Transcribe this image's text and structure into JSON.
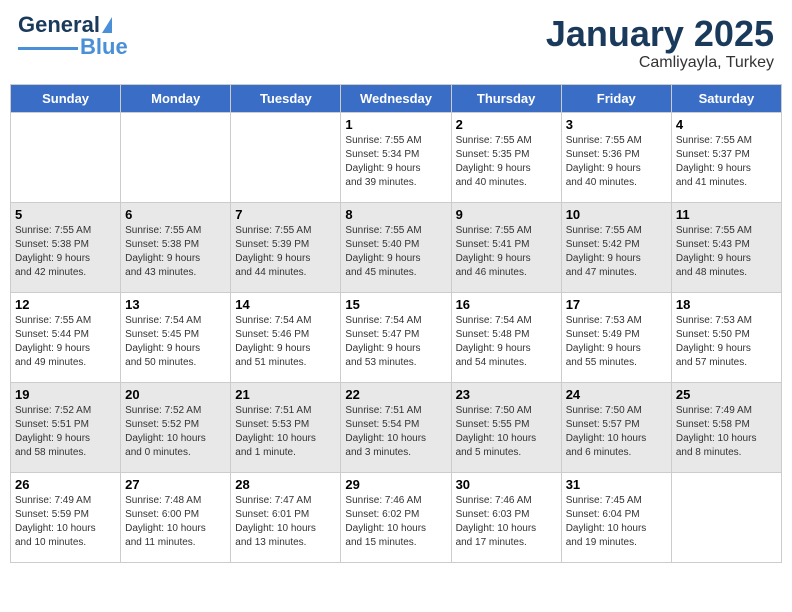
{
  "header": {
    "logo_text_general": "General",
    "logo_text_blue": "Blue",
    "month": "January 2025",
    "location": "Camliyayla, Turkey"
  },
  "days_of_week": [
    "Sunday",
    "Monday",
    "Tuesday",
    "Wednesday",
    "Thursday",
    "Friday",
    "Saturday"
  ],
  "weeks": [
    [
      {
        "day": "",
        "info": ""
      },
      {
        "day": "",
        "info": ""
      },
      {
        "day": "",
        "info": ""
      },
      {
        "day": "1",
        "info": "Sunrise: 7:55 AM\nSunset: 5:34 PM\nDaylight: 9 hours\nand 39 minutes."
      },
      {
        "day": "2",
        "info": "Sunrise: 7:55 AM\nSunset: 5:35 PM\nDaylight: 9 hours\nand 40 minutes."
      },
      {
        "day": "3",
        "info": "Sunrise: 7:55 AM\nSunset: 5:36 PM\nDaylight: 9 hours\nand 40 minutes."
      },
      {
        "day": "4",
        "info": "Sunrise: 7:55 AM\nSunset: 5:37 PM\nDaylight: 9 hours\nand 41 minutes."
      }
    ],
    [
      {
        "day": "5",
        "info": "Sunrise: 7:55 AM\nSunset: 5:38 PM\nDaylight: 9 hours\nand 42 minutes."
      },
      {
        "day": "6",
        "info": "Sunrise: 7:55 AM\nSunset: 5:38 PM\nDaylight: 9 hours\nand 43 minutes."
      },
      {
        "day": "7",
        "info": "Sunrise: 7:55 AM\nSunset: 5:39 PM\nDaylight: 9 hours\nand 44 minutes."
      },
      {
        "day": "8",
        "info": "Sunrise: 7:55 AM\nSunset: 5:40 PM\nDaylight: 9 hours\nand 45 minutes."
      },
      {
        "day": "9",
        "info": "Sunrise: 7:55 AM\nSunset: 5:41 PM\nDaylight: 9 hours\nand 46 minutes."
      },
      {
        "day": "10",
        "info": "Sunrise: 7:55 AM\nSunset: 5:42 PM\nDaylight: 9 hours\nand 47 minutes."
      },
      {
        "day": "11",
        "info": "Sunrise: 7:55 AM\nSunset: 5:43 PM\nDaylight: 9 hours\nand 48 minutes."
      }
    ],
    [
      {
        "day": "12",
        "info": "Sunrise: 7:55 AM\nSunset: 5:44 PM\nDaylight: 9 hours\nand 49 minutes."
      },
      {
        "day": "13",
        "info": "Sunrise: 7:54 AM\nSunset: 5:45 PM\nDaylight: 9 hours\nand 50 minutes."
      },
      {
        "day": "14",
        "info": "Sunrise: 7:54 AM\nSunset: 5:46 PM\nDaylight: 9 hours\nand 51 minutes."
      },
      {
        "day": "15",
        "info": "Sunrise: 7:54 AM\nSunset: 5:47 PM\nDaylight: 9 hours\nand 53 minutes."
      },
      {
        "day": "16",
        "info": "Sunrise: 7:54 AM\nSunset: 5:48 PM\nDaylight: 9 hours\nand 54 minutes."
      },
      {
        "day": "17",
        "info": "Sunrise: 7:53 AM\nSunset: 5:49 PM\nDaylight: 9 hours\nand 55 minutes."
      },
      {
        "day": "18",
        "info": "Sunrise: 7:53 AM\nSunset: 5:50 PM\nDaylight: 9 hours\nand 57 minutes."
      }
    ],
    [
      {
        "day": "19",
        "info": "Sunrise: 7:52 AM\nSunset: 5:51 PM\nDaylight: 9 hours\nand 58 minutes."
      },
      {
        "day": "20",
        "info": "Sunrise: 7:52 AM\nSunset: 5:52 PM\nDaylight: 10 hours\nand 0 minutes."
      },
      {
        "day": "21",
        "info": "Sunrise: 7:51 AM\nSunset: 5:53 PM\nDaylight: 10 hours\nand 1 minute."
      },
      {
        "day": "22",
        "info": "Sunrise: 7:51 AM\nSunset: 5:54 PM\nDaylight: 10 hours\nand 3 minutes."
      },
      {
        "day": "23",
        "info": "Sunrise: 7:50 AM\nSunset: 5:55 PM\nDaylight: 10 hours\nand 5 minutes."
      },
      {
        "day": "24",
        "info": "Sunrise: 7:50 AM\nSunset: 5:57 PM\nDaylight: 10 hours\nand 6 minutes."
      },
      {
        "day": "25",
        "info": "Sunrise: 7:49 AM\nSunset: 5:58 PM\nDaylight: 10 hours\nand 8 minutes."
      }
    ],
    [
      {
        "day": "26",
        "info": "Sunrise: 7:49 AM\nSunset: 5:59 PM\nDaylight: 10 hours\nand 10 minutes."
      },
      {
        "day": "27",
        "info": "Sunrise: 7:48 AM\nSunset: 6:00 PM\nDaylight: 10 hours\nand 11 minutes."
      },
      {
        "day": "28",
        "info": "Sunrise: 7:47 AM\nSunset: 6:01 PM\nDaylight: 10 hours\nand 13 minutes."
      },
      {
        "day": "29",
        "info": "Sunrise: 7:46 AM\nSunset: 6:02 PM\nDaylight: 10 hours\nand 15 minutes."
      },
      {
        "day": "30",
        "info": "Sunrise: 7:46 AM\nSunset: 6:03 PM\nDaylight: 10 hours\nand 17 minutes."
      },
      {
        "day": "31",
        "info": "Sunrise: 7:45 AM\nSunset: 6:04 PM\nDaylight: 10 hours\nand 19 minutes."
      },
      {
        "day": "",
        "info": ""
      }
    ]
  ]
}
